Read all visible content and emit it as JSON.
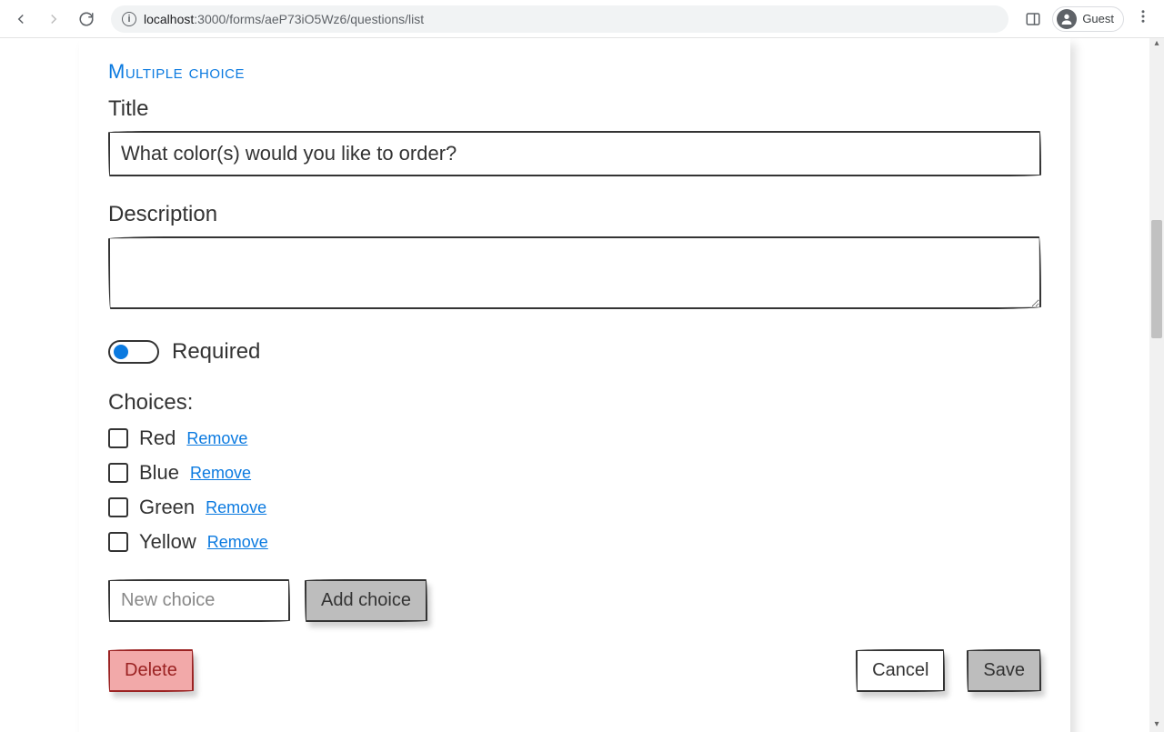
{
  "browser": {
    "url_host": "localhost",
    "url_rest": ":3000/forms/aeP73iO5Wz6/questions/list",
    "guest_label": "Guest"
  },
  "form": {
    "section_label": "Multiple choice",
    "title_label": "Title",
    "title_value": "What color(s) would you like to order?",
    "description_label": "Description",
    "description_value": "",
    "required_label": "Required",
    "required_on": true,
    "choices_label": "Choices:",
    "choices": [
      {
        "label": "Red"
      },
      {
        "label": "Blue"
      },
      {
        "label": "Green"
      },
      {
        "label": "Yellow"
      }
    ],
    "remove_link_label": "Remove",
    "new_choice_placeholder": "New choice",
    "add_choice_label": "Add choice",
    "delete_label": "Delete",
    "cancel_label": "Cancel",
    "save_label": "Save"
  }
}
